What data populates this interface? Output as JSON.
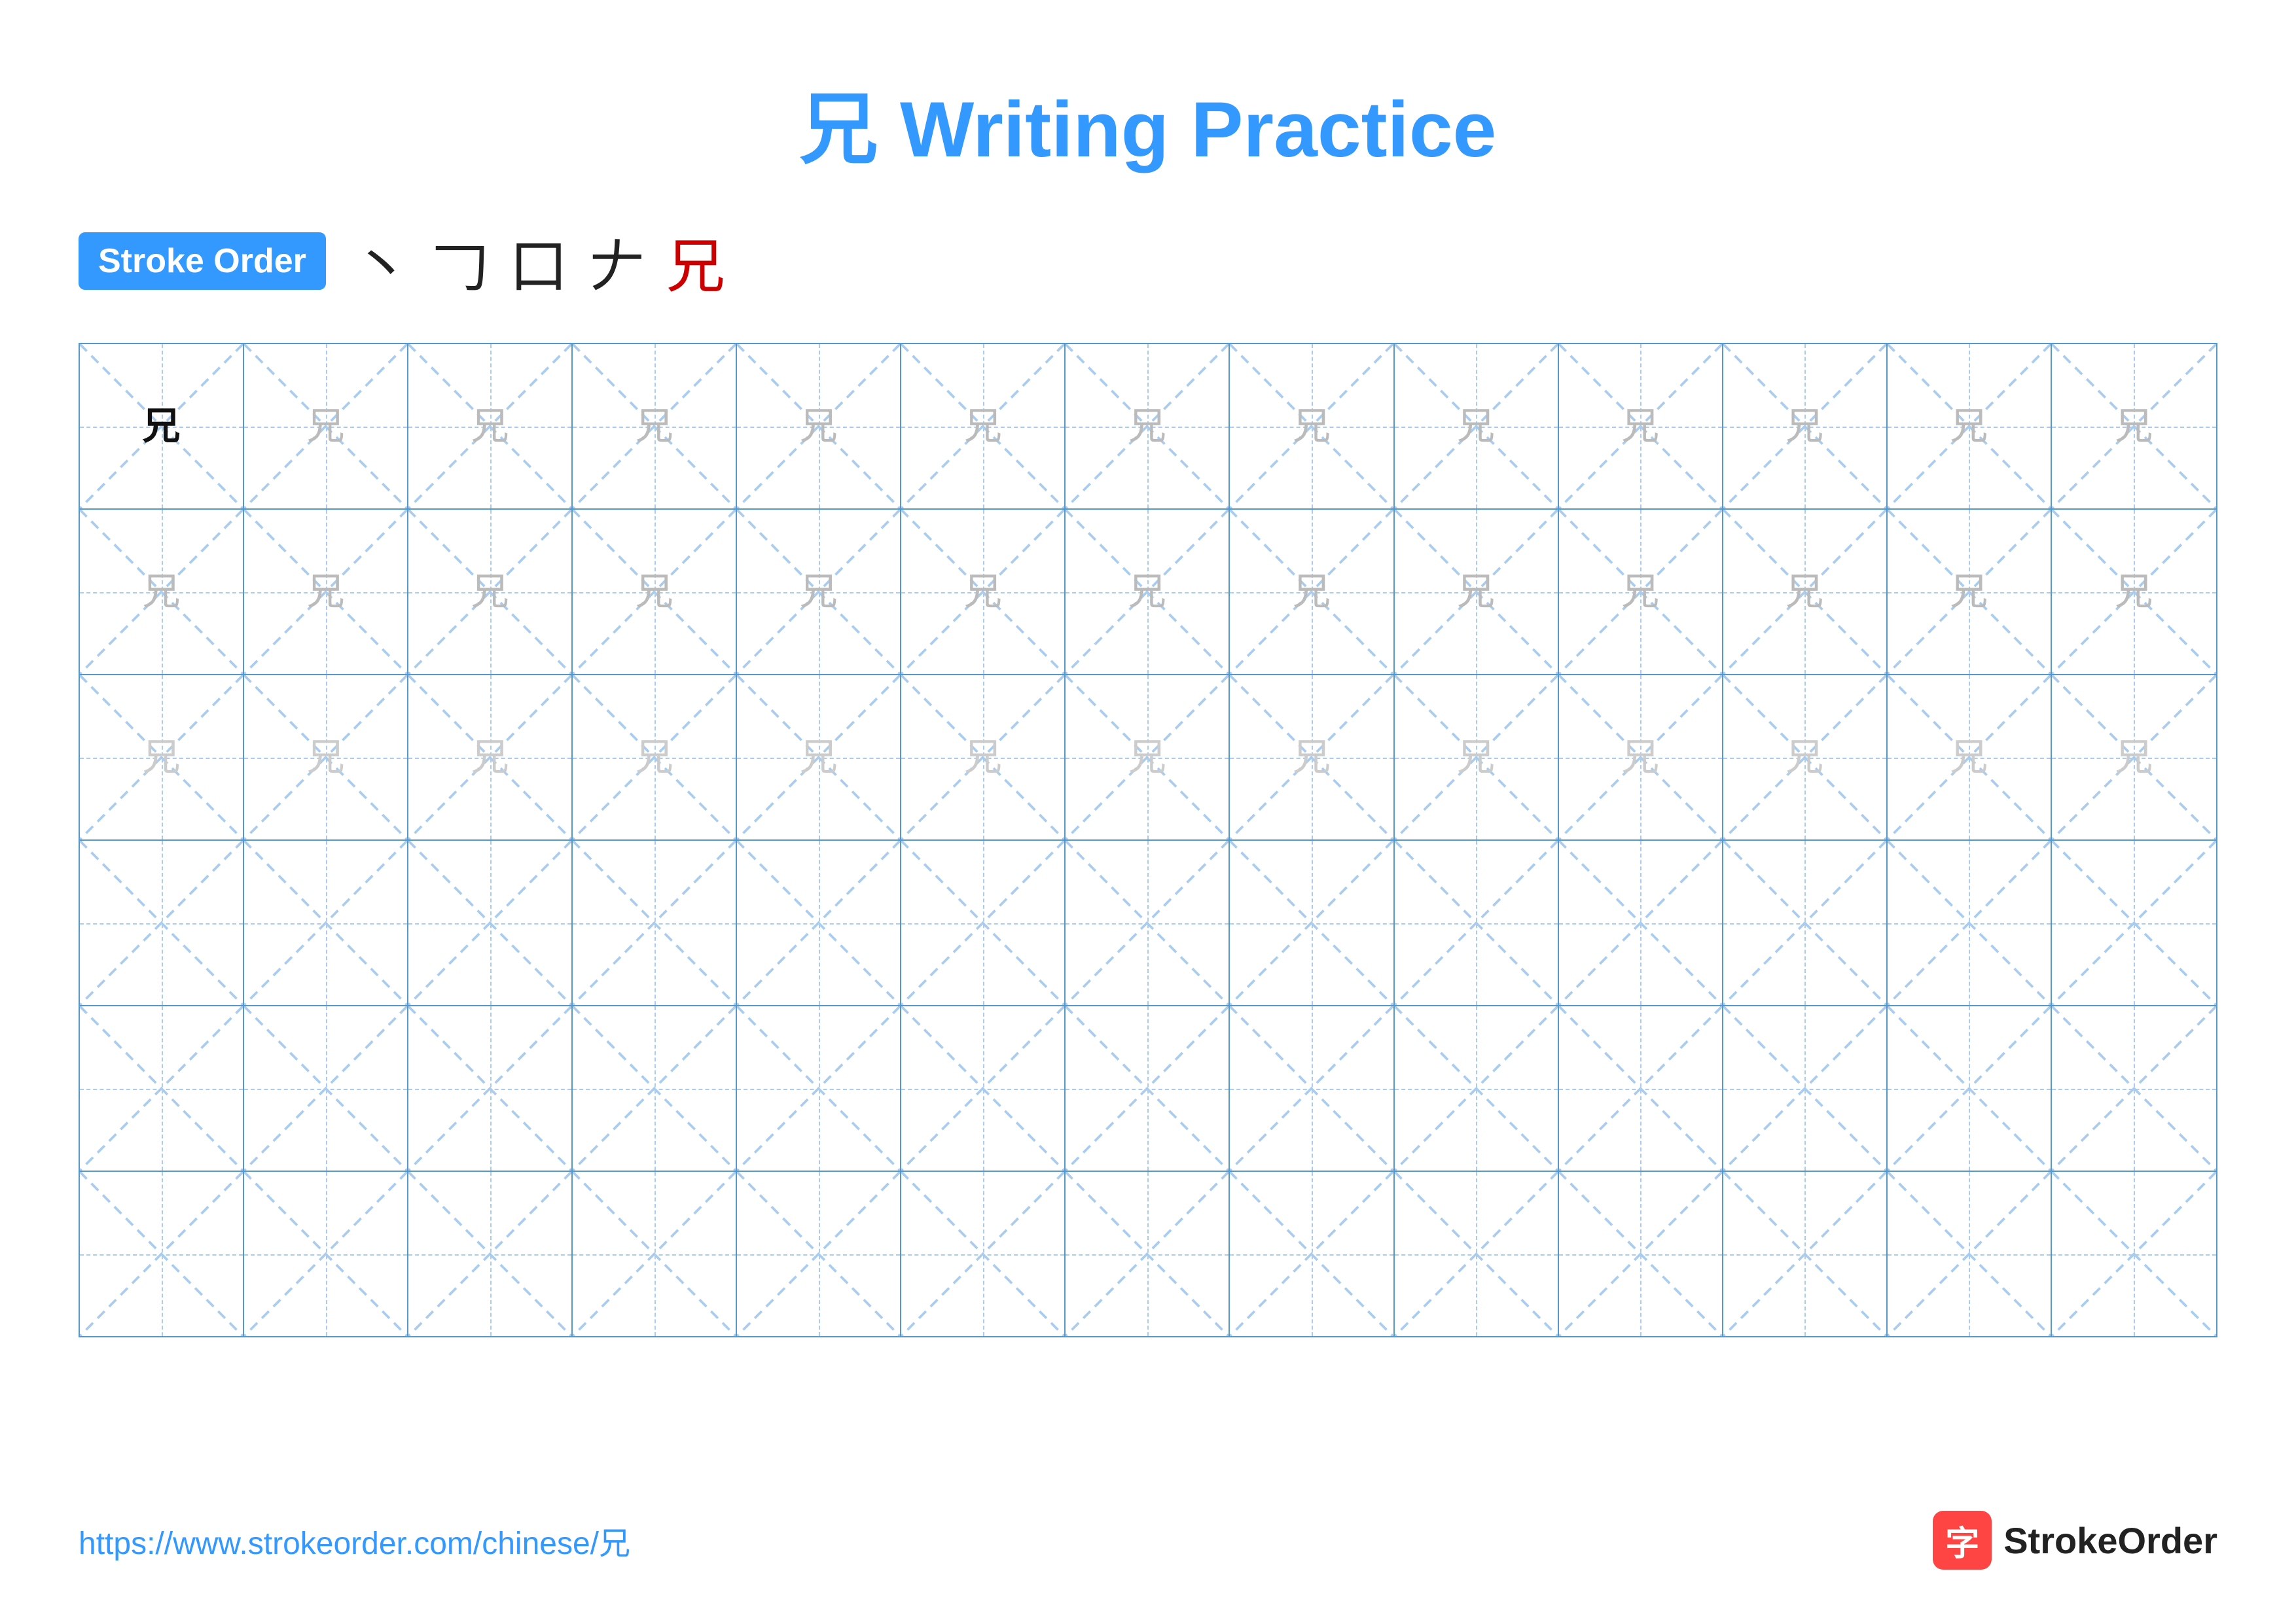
{
  "title": "兄 Writing Practice",
  "stroke_order": {
    "label": "Stroke Order",
    "strokes": [
      "丶",
      "𠃌",
      "口",
      "𠂇",
      "兄"
    ],
    "stroke_colors": [
      "black",
      "black",
      "black",
      "black",
      "red"
    ]
  },
  "character": "兄",
  "grid": {
    "rows": 6,
    "cols": 13,
    "row_configs": [
      {
        "type": "dark_then_light1",
        "dark_count": 1
      },
      {
        "type": "light1_all"
      },
      {
        "type": "light2_all"
      },
      {
        "type": "empty"
      },
      {
        "type": "empty"
      },
      {
        "type": "empty"
      }
    ]
  },
  "footer": {
    "url": "https://www.strokeorder.com/chinese/兄",
    "logo_icon": "字",
    "logo_text": "StrokeOrder"
  }
}
